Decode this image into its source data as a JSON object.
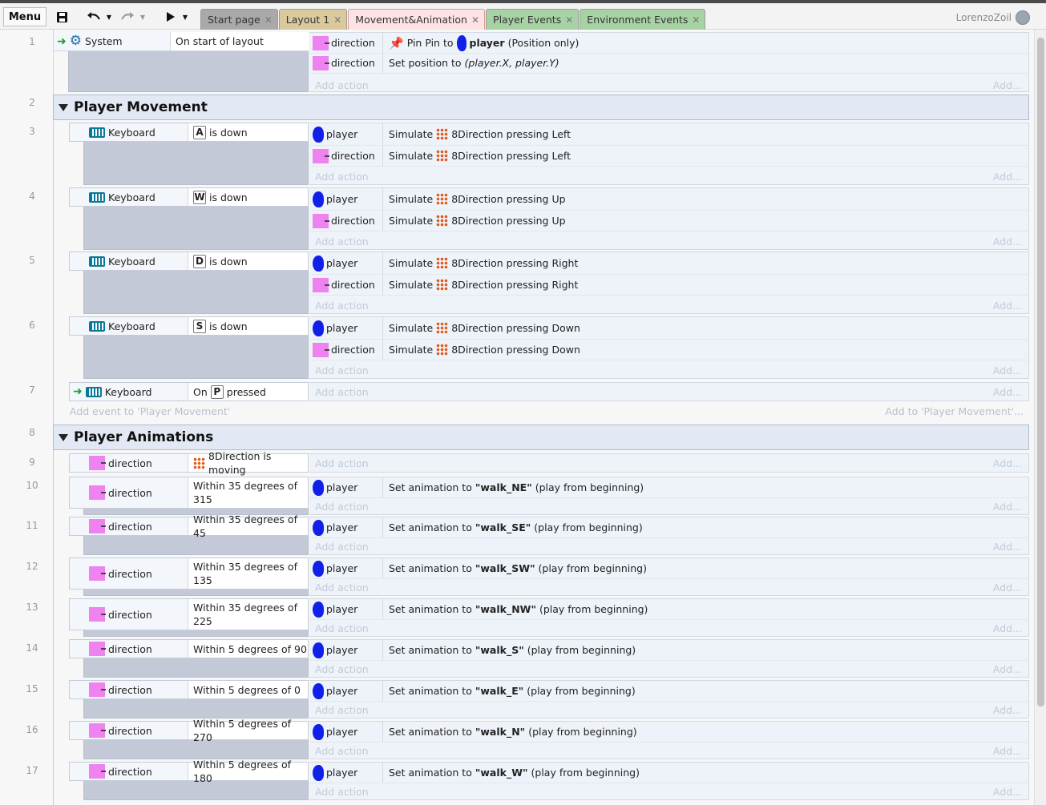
{
  "toolbar": {
    "menu_label": "Menu"
  },
  "tabs": [
    {
      "label": "Start page",
      "color": "#a9a9a9"
    },
    {
      "label": "Layout 1",
      "color": "#d9c99c"
    },
    {
      "label": "Movement&Animation",
      "color": "#fde3e3"
    },
    {
      "label": "Player Events",
      "color": "#a7d3a4"
    },
    {
      "label": "Environment Events",
      "color": "#a7d3a4"
    }
  ],
  "user": {
    "name": "LorenzoZoil"
  },
  "events": {
    "e1": {
      "num": "1",
      "obj": "System",
      "cond": "On start of layout",
      "a1_obj": "direction",
      "a1_pre": "Pin Pin to",
      "a1_target": "player",
      "a1_post": "(Position only)",
      "a2_obj": "direction",
      "a2_txt": "Set position to",
      "a2_expr": "(player.X, player.Y)",
      "add_action": "Add action",
      "add_right": "Add..."
    },
    "g2": {
      "num": "2",
      "title": "Player Movement"
    },
    "e3": {
      "num": "3",
      "obj": "Keyboard",
      "key": "A",
      "cond": "is down",
      "a1_obj": "player",
      "a1_txt": "Simulate",
      "a1_beh": "8Direction pressing Left",
      "a2_obj": "direction",
      "a2_txt": "Simulate",
      "a2_beh": "8Direction pressing Left"
    },
    "e4": {
      "num": "4",
      "obj": "Keyboard",
      "key": "W",
      "cond": "is down",
      "a1_obj": "player",
      "a1_txt": "Simulate",
      "a1_beh": "8Direction pressing Up",
      "a2_obj": "direction",
      "a2_txt": "Simulate",
      "a2_beh": "8Direction pressing Up"
    },
    "e5": {
      "num": "5",
      "obj": "Keyboard",
      "key": "D",
      "cond": "is down",
      "a1_obj": "player",
      "a1_txt": "Simulate",
      "a1_beh": "8Direction pressing Right",
      "a2_obj": "direction",
      "a2_txt": "Simulate",
      "a2_beh": "8Direction pressing Right"
    },
    "e6": {
      "num": "6",
      "obj": "Keyboard",
      "key": "S",
      "cond": "is down",
      "a1_obj": "player",
      "a1_txt": "Simulate",
      "a1_beh": "8Direction pressing Down",
      "a2_obj": "direction",
      "a2_txt": "Simulate",
      "a2_beh": "8Direction pressing Down"
    },
    "e7": {
      "num": "7",
      "obj": "Keyboard",
      "pre": "On",
      "key": "P",
      "cond": "pressed"
    },
    "add_event_movement": "Add event to 'Player Movement'",
    "add_to_movement": "Add to 'Player Movement'...",
    "g8": {
      "num": "8",
      "title": "Player Animations"
    },
    "e9": {
      "num": "9",
      "obj": "direction",
      "cond": "8Direction is moving"
    },
    "anim": [
      {
        "num": "10",
        "obj": "direction",
        "cond": "Within 35 degrees of 315",
        "aobj": "player",
        "pre": "Set animation to",
        "anim": "\"walk_NE\"",
        "post": "(play from beginning)"
      },
      {
        "num": "11",
        "obj": "direction",
        "cond": "Within 35 degrees of 45",
        "aobj": "player",
        "pre": "Set animation to",
        "anim": "\"walk_SE\"",
        "post": "(play from beginning)"
      },
      {
        "num": "12",
        "obj": "direction",
        "cond": "Within 35 degrees of 135",
        "aobj": "player",
        "pre": "Set animation to",
        "anim": "\"walk_SW\"",
        "post": "(play from beginning)"
      },
      {
        "num": "13",
        "obj": "direction",
        "cond": "Within 35 degrees of 225",
        "aobj": "player",
        "pre": "Set animation to",
        "anim": "\"walk_NW\"",
        "post": "(play from beginning)"
      },
      {
        "num": "14",
        "obj": "direction",
        "cond": "Within 5 degrees of 90",
        "aobj": "player",
        "pre": "Set animation to",
        "anim": "\"walk_S\"",
        "post": "(play from beginning)"
      },
      {
        "num": "15",
        "obj": "direction",
        "cond": "Within 5 degrees of 0",
        "aobj": "player",
        "pre": "Set animation to",
        "anim": "\"walk_E\"",
        "post": "(play from beginning)"
      },
      {
        "num": "16",
        "obj": "direction",
        "cond": "Within 5 degrees of 270",
        "aobj": "player",
        "pre": "Set animation to",
        "anim": "\"walk_N\"",
        "post": "(play from beginning)"
      },
      {
        "num": "17",
        "obj": "direction",
        "cond": "Within 5 degrees of 180",
        "aobj": "player",
        "pre": "Set animation to",
        "anim": "\"walk_W\"",
        "post": "(play from beginning)"
      }
    ]
  }
}
